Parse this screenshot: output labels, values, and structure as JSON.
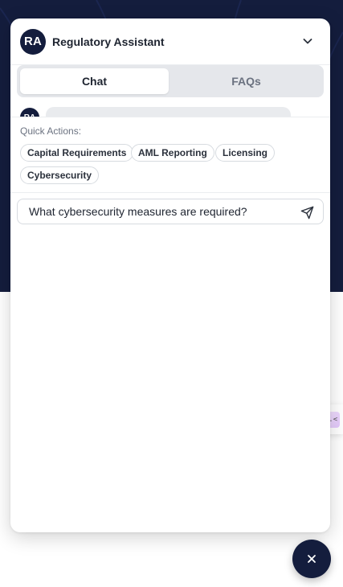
{
  "header": {
    "avatar_initials": "RA",
    "title": "Regulatory Assistant",
    "collapse_icon": "chevron-down-icon"
  },
  "tabs": [
    {
      "label": "Chat",
      "active": true
    },
    {
      "label": "FAQs",
      "active": false
    }
  ],
  "messages": {
    "peek_avatar_initials": "RA"
  },
  "quick_actions": {
    "label": "Quick Actions:",
    "chips": [
      "Capital Requirements",
      "AML Reporting",
      "Licensing",
      "Cybersecurity"
    ]
  },
  "composer": {
    "value": "What cybersecurity measures are required?",
    "send_icon": "send-icon"
  },
  "fab": {
    "icon": "close-icon"
  },
  "side_widget": {
    "glyph": ">.<"
  },
  "colors": {
    "navy": "#141d3d",
    "tab_track": "#e5e7eb",
    "muted_text": "#6b7280"
  }
}
